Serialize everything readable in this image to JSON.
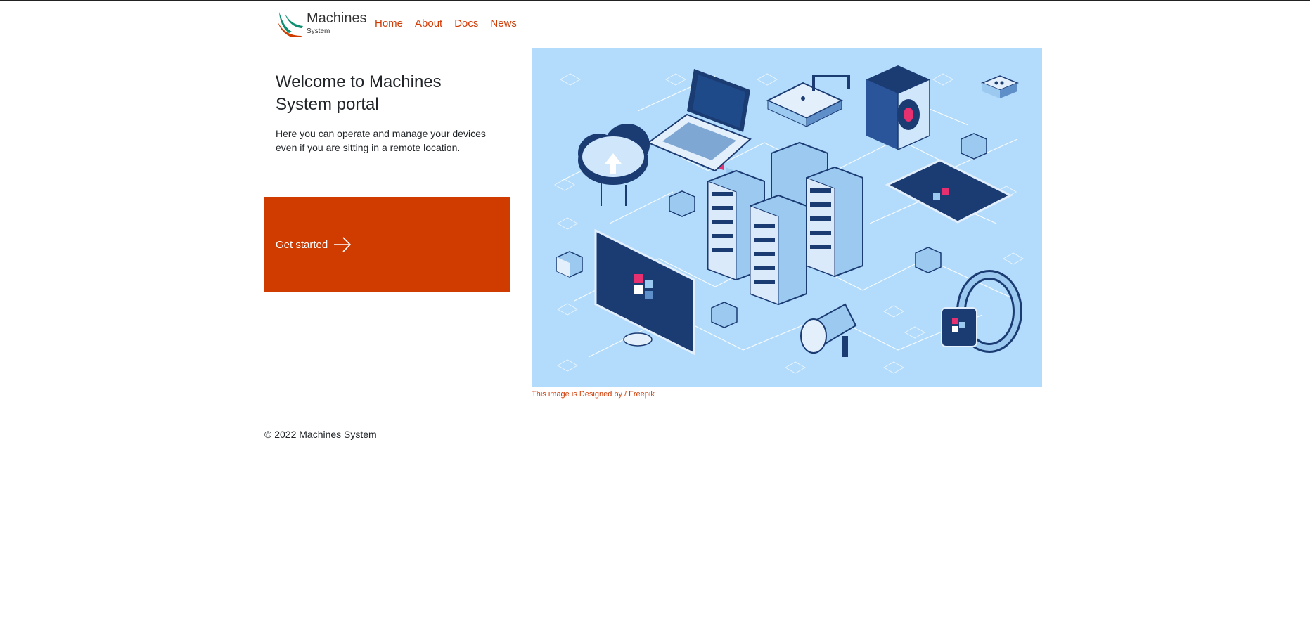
{
  "brand": {
    "name": "Machines",
    "tagline": "System",
    "logo_colors": [
      "#0f8f72",
      "#d03c00"
    ]
  },
  "nav": [
    {
      "label": "Home"
    },
    {
      "label": "About"
    },
    {
      "label": "Docs"
    },
    {
      "label": "News"
    }
  ],
  "hero": {
    "title": "Welcome to Machines System portal",
    "description": "Here you can operate and manage your devices even if you are sitting in a remote location.",
    "cta_label": "Get started",
    "cta_icon": "arrow-right-icon"
  },
  "illustration": {
    "icons": [
      "cloud-upload-icon",
      "laptop-icon",
      "router-icon",
      "action-camera-icon",
      "server-rack-icon",
      "tablet-icon",
      "monitor-icon",
      "megaphone-icon",
      "smartwatch-icon"
    ]
  },
  "credit": "This image is Designed by / Freepik",
  "footer": {
    "copyright": "© 2022 Machines System"
  },
  "colors": {
    "accent": "#d03c00",
    "illustration_bg": "#b3dbfb",
    "device_dark": "#1b3b73"
  }
}
